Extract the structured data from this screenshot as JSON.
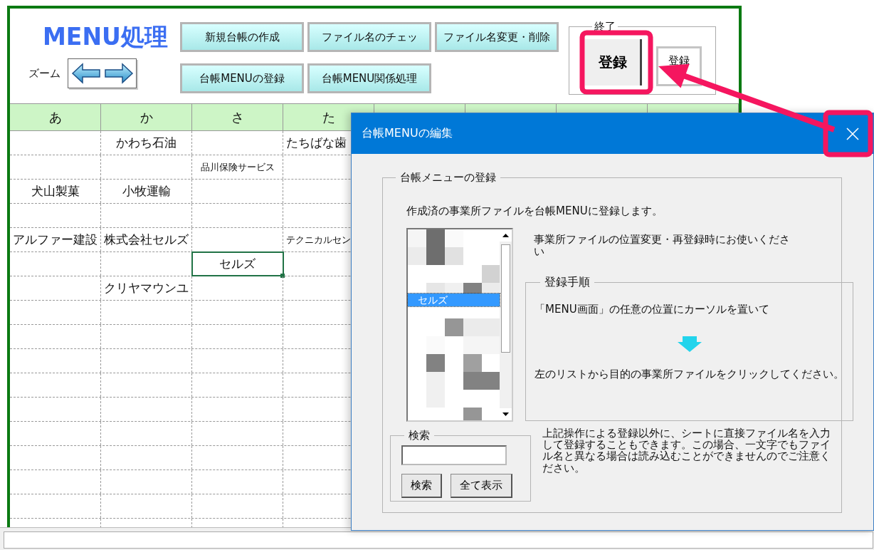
{
  "sheet": {
    "title": "MENU処理",
    "zoom_label": "ズーム",
    "menu_buttons": [
      [
        "新規台帳の作成",
        "ファイル名のチェッ",
        "ファイル名変更・削除"
      ],
      [
        "台帳MENUの登録",
        "台帳MENU関係処理"
      ]
    ],
    "end_group": {
      "legend": "終了",
      "buttons": [
        {
          "label": "登録",
          "kind": "large"
        },
        {
          "label": "登録",
          "kind": "small"
        }
      ]
    },
    "columns": [
      "あ",
      "か",
      "さ",
      "た"
    ],
    "rows": [
      {
        "cells": [
          null,
          {
            "text": "かわち石油",
            "selected": false
          },
          null,
          {
            "text": "たちばな歯",
            "selected": false
          }
        ]
      },
      {
        "cells": [
          null,
          null,
          {
            "text": "品川保険サービス",
            "selected": false
          },
          null
        ]
      },
      {
        "cells": [
          {
            "text": "犬山製菓",
            "selected": false
          },
          {
            "text": "小牧運輸",
            "selected": false
          },
          null,
          null
        ]
      },
      {
        "cells": [
          null,
          null,
          null,
          null
        ]
      },
      {
        "cells": [
          {
            "text": "アルファー建設",
            "selected": false
          },
          {
            "text": "株式会社セルズ",
            "selected": false
          },
          null,
          {
            "text": "テクニカルセン",
            "selected": false
          }
        ]
      },
      {
        "cells": [
          null,
          null,
          {
            "text": "セルズ",
            "selected": true
          },
          null
        ]
      },
      {
        "cells": [
          null,
          {
            "text": "クリヤマウンユ",
            "selected": false
          },
          null,
          null
        ]
      }
    ]
  },
  "dialog": {
    "title": "台帳MENUの編集",
    "group": {
      "legend": "台帳メニューの登録",
      "intro": "作成済の事業所ファイルを台帳MENUに登録します。",
      "list": {
        "items": [
          {
            "label": "セルズ",
            "selected": true
          }
        ]
      },
      "note": "事業所ファイルの位置変更・再登録時にお使いください",
      "steps": {
        "legend": "登録手順",
        "lines": [
          "「MENU画面」の任意の位置にカーソルを置いて",
          "左のリストから目的の事業所ファイルをクリックしてください。"
        ]
      },
      "search": {
        "legend": "検索",
        "buttons": [
          "検索",
          "全て表示"
        ]
      },
      "remark": "上記操作による登録以外に、シートに直接ファイル名を入力して登録することもできます。この場合、一文字でもファイル名と異なる場合は読み込むことができませんのでご注意ください。"
    }
  }
}
